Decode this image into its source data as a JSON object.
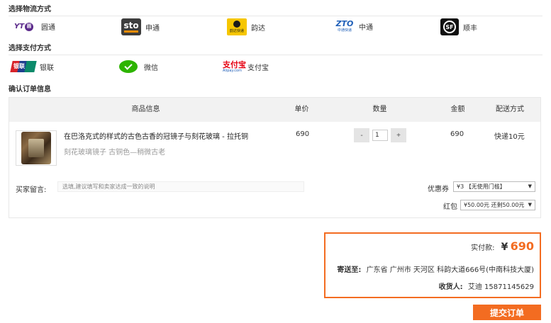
{
  "logistics": {
    "title": "选择物流方式",
    "options": [
      {
        "label": "圆通",
        "icon": "yto-logo"
      },
      {
        "label": "申通",
        "icon": "sto-logo"
      },
      {
        "label": "韵达",
        "icon": "yunda-logo"
      },
      {
        "label": "中通",
        "icon": "zto-logo"
      },
      {
        "label": "顺丰",
        "icon": "sf-logo"
      }
    ]
  },
  "payment": {
    "title": "选择支付方式",
    "options": [
      {
        "label": "银联",
        "icon": "unionpay-logo"
      },
      {
        "label": "微信",
        "icon": "wechat-logo"
      },
      {
        "label": "支付宝",
        "icon": "alipay-logo"
      }
    ]
  },
  "order": {
    "title": "确认订单信息",
    "headers": [
      "商品信息",
      "单价",
      "数量",
      "金额",
      "配送方式"
    ],
    "item": {
      "name": "在巴洛克式的样式的古色古香的冠镜子与刻花玻璃 - 拉托铜",
      "sku": "刻花玻璃镜子 古铜色—稍微古老",
      "unit_price": "690",
      "quantity": "1",
      "amount": "690",
      "delivery": "快递10元"
    },
    "stepper": {
      "minus": "-",
      "plus": "+"
    },
    "message": {
      "label": "买家留言:",
      "placeholder": "选填,建议填写和卖家达成一致的说明"
    },
    "coupon": {
      "label": "优惠券",
      "selected": "¥3 【无使用门槛】"
    },
    "redpack": {
      "label": "红包",
      "selected": "¥50.00元 还剩50.00元"
    }
  },
  "summary": {
    "paid_label": "实付款:",
    "currency": "¥",
    "paid_amount": "690",
    "ship_to_label": "寄送至:",
    "address": "广东省 广州市 天河区 科韵大道666号(中南科技大厦)",
    "receiver_label": "收货人:",
    "receiver": "艾迪 15871145629"
  },
  "submit_label": "提交订单",
  "colors": {
    "accent": "#f36c21"
  }
}
